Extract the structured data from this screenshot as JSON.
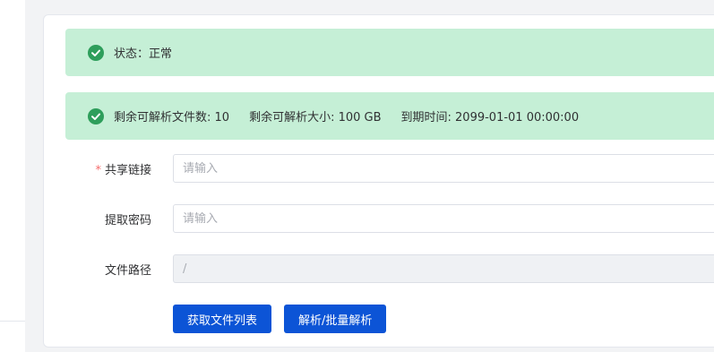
{
  "status_alert": {
    "label": "状态：",
    "value": "正常"
  },
  "quota_alert": {
    "remaining_files": "剩余可解析文件数: 10",
    "remaining_size": "剩余可解析大小: 100 GB",
    "expiry": "到期时间: 2099-01-01 00:00:00"
  },
  "form": {
    "share_link": {
      "required_mark": "*",
      "label": "共享链接",
      "placeholder": "请输入",
      "value": ""
    },
    "extract_code": {
      "label": "提取密码",
      "placeholder": "请输入",
      "value": ""
    },
    "file_path": {
      "label": "文件路径",
      "value": "/"
    }
  },
  "buttons": {
    "get_file_list": "获取文件列表",
    "parse_batch": "解析/批量解析"
  },
  "colors": {
    "success_bg": "#c5efd6",
    "success_icon": "#2e9e5b",
    "primary": "#0c54d6",
    "required": "#f56c6c"
  }
}
